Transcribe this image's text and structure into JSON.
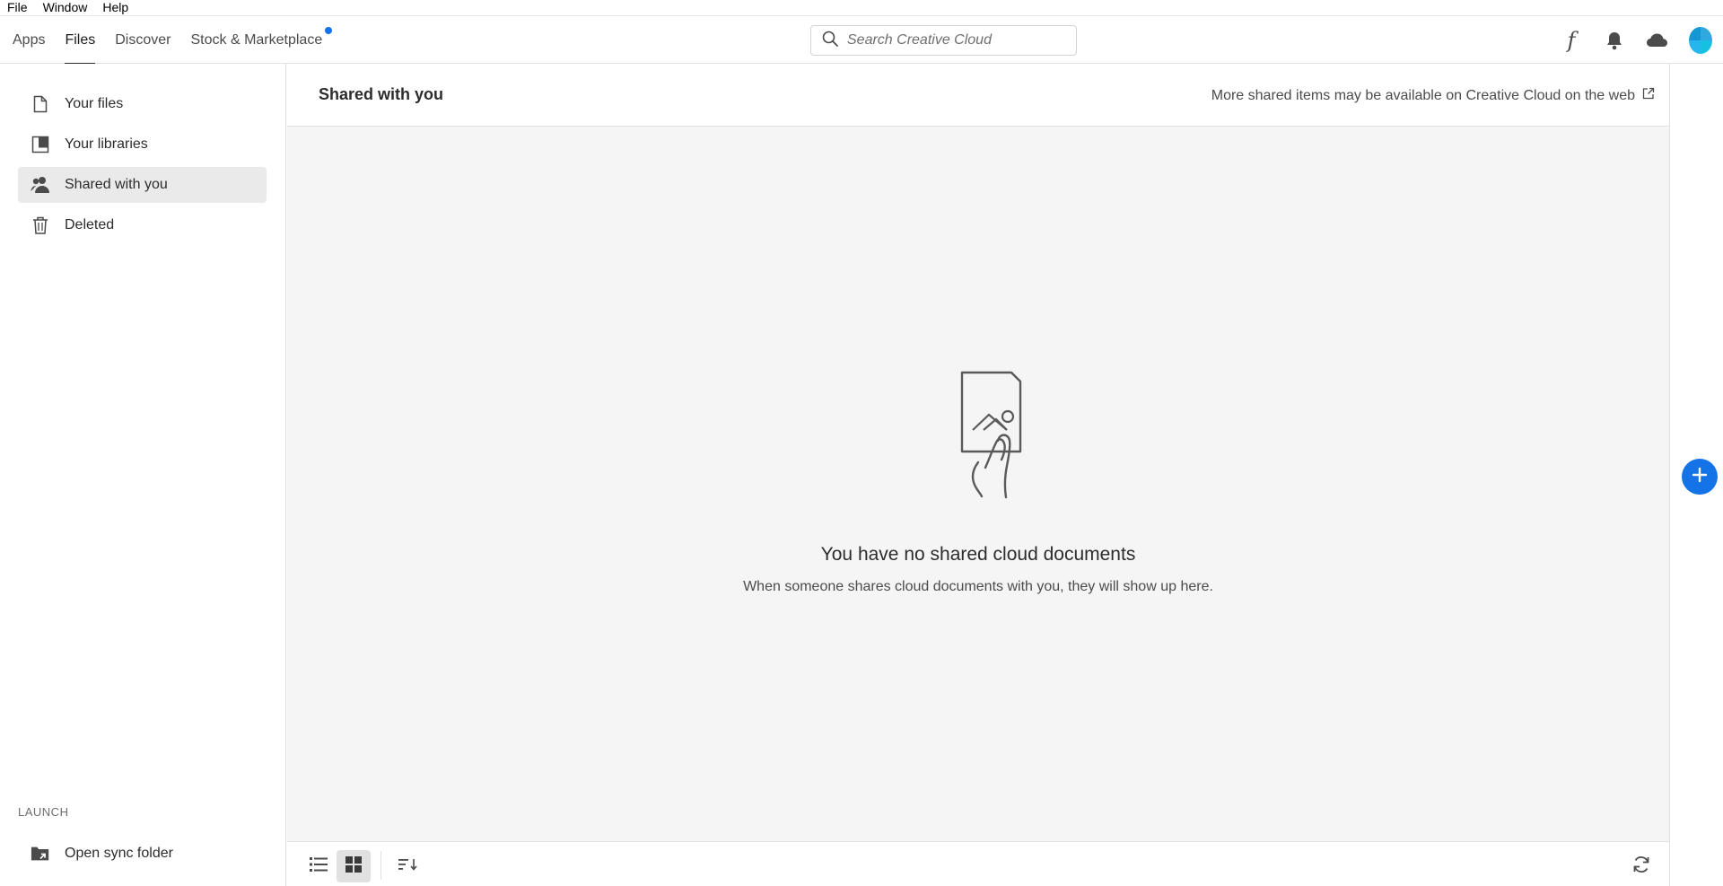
{
  "menubar": [
    "File",
    "Window",
    "Help"
  ],
  "nav": {
    "tabs": [
      {
        "label": "Apps"
      },
      {
        "label": "Files"
      },
      {
        "label": "Discover"
      },
      {
        "label": "Stock & Marketplace"
      }
    ],
    "active_tab": "Files",
    "search_placeholder": "Search Creative Cloud",
    "icons": [
      "fonts-icon",
      "bell-icon",
      "cloud-icon",
      "avatar"
    ]
  },
  "sidebar": {
    "items": [
      {
        "label": "Your files",
        "icon": "file-icon"
      },
      {
        "label": "Your libraries",
        "icon": "libraries-icon"
      },
      {
        "label": "Shared with you",
        "icon": "shared-user-icon"
      },
      {
        "label": "Deleted",
        "icon": "trash-icon"
      }
    ],
    "active_item": "Shared with you",
    "launch_label": "LAUNCH",
    "open_sync_folder": "Open sync folder"
  },
  "main": {
    "title": "Shared with you",
    "more_link": "More shared items may be available on Creative Cloud on the web",
    "empty_title": "You have no shared cloud documents",
    "empty_subtitle": "When someone shares cloud documents with you, they will show up here."
  },
  "colors": {
    "accent": "#1473e6",
    "content_bg": "#f5f5f5",
    "text": "#2c2c2c"
  }
}
